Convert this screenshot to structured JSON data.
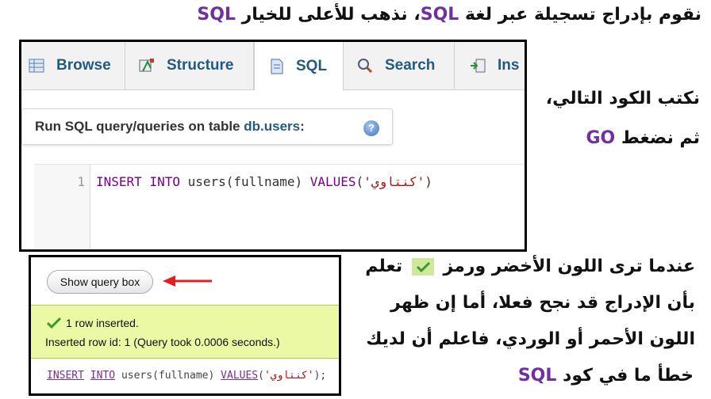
{
  "heading": {
    "pre": "نقوم بإدراج تسجيلة عبر لغة ",
    "kw1": "SQL",
    "mid": "، نذهب للأعلى للخيار ",
    "kw2": "SQL"
  },
  "tabs": [
    {
      "label": "Browse",
      "icon": "table-icon"
    },
    {
      "label": "Structure",
      "icon": "structure-icon"
    },
    {
      "label": "SQL",
      "icon": "sql-doc-icon",
      "active": true
    },
    {
      "label": "Search",
      "icon": "magnifier-icon"
    },
    {
      "label": "Ins",
      "icon": "insert-icon"
    }
  ],
  "query_panel": {
    "title_prefix": "Run SQL query/queries on table ",
    "table": "db.users",
    "title_suffix": ":"
  },
  "editor": {
    "line_number": "1",
    "kw_insert": "INSERT",
    "kw_into": "INTO",
    "table_part": "users(fullname)",
    "kw_values": "VALUES",
    "open": "(",
    "string": "'كنتاوي'",
    "close": ")"
  },
  "instructions1": {
    "line1": "نكتب الكود التالي،",
    "line2_pre": "ثم نضغط ",
    "line2_kw": "GO"
  },
  "result": {
    "show_query_button": "Show query box",
    "success_line1": "1 row inserted.",
    "success_line2": "Inserted row id: 1 (Query took 0.0006 seconds.)",
    "sql_insert": "INSERT",
    "sql_into": "INTO",
    "sql_table": "users(fullname)",
    "sql_values": "VALUES",
    "sql_string": "'كنتاوي'",
    "sql_tail": ");"
  },
  "instructions2": {
    "line1_pre": "عندما ترى اللون الأخضر ورمز ",
    "line1_post": " تعلم",
    "line2": "بأن الإدراج قد نجح فعلا، أما إن ظهر",
    "line3": "اللون الأحمر أو الوردي، فاعلم أن لديك",
    "line4_pre": "خطأ ما في كود ",
    "line4_kw": "SQL"
  },
  "colors": {
    "keyword_purple": "#7030a0",
    "tab_text": "#235a81",
    "success_bg": "#ebf8a4",
    "arrow_red": "#e02020"
  }
}
